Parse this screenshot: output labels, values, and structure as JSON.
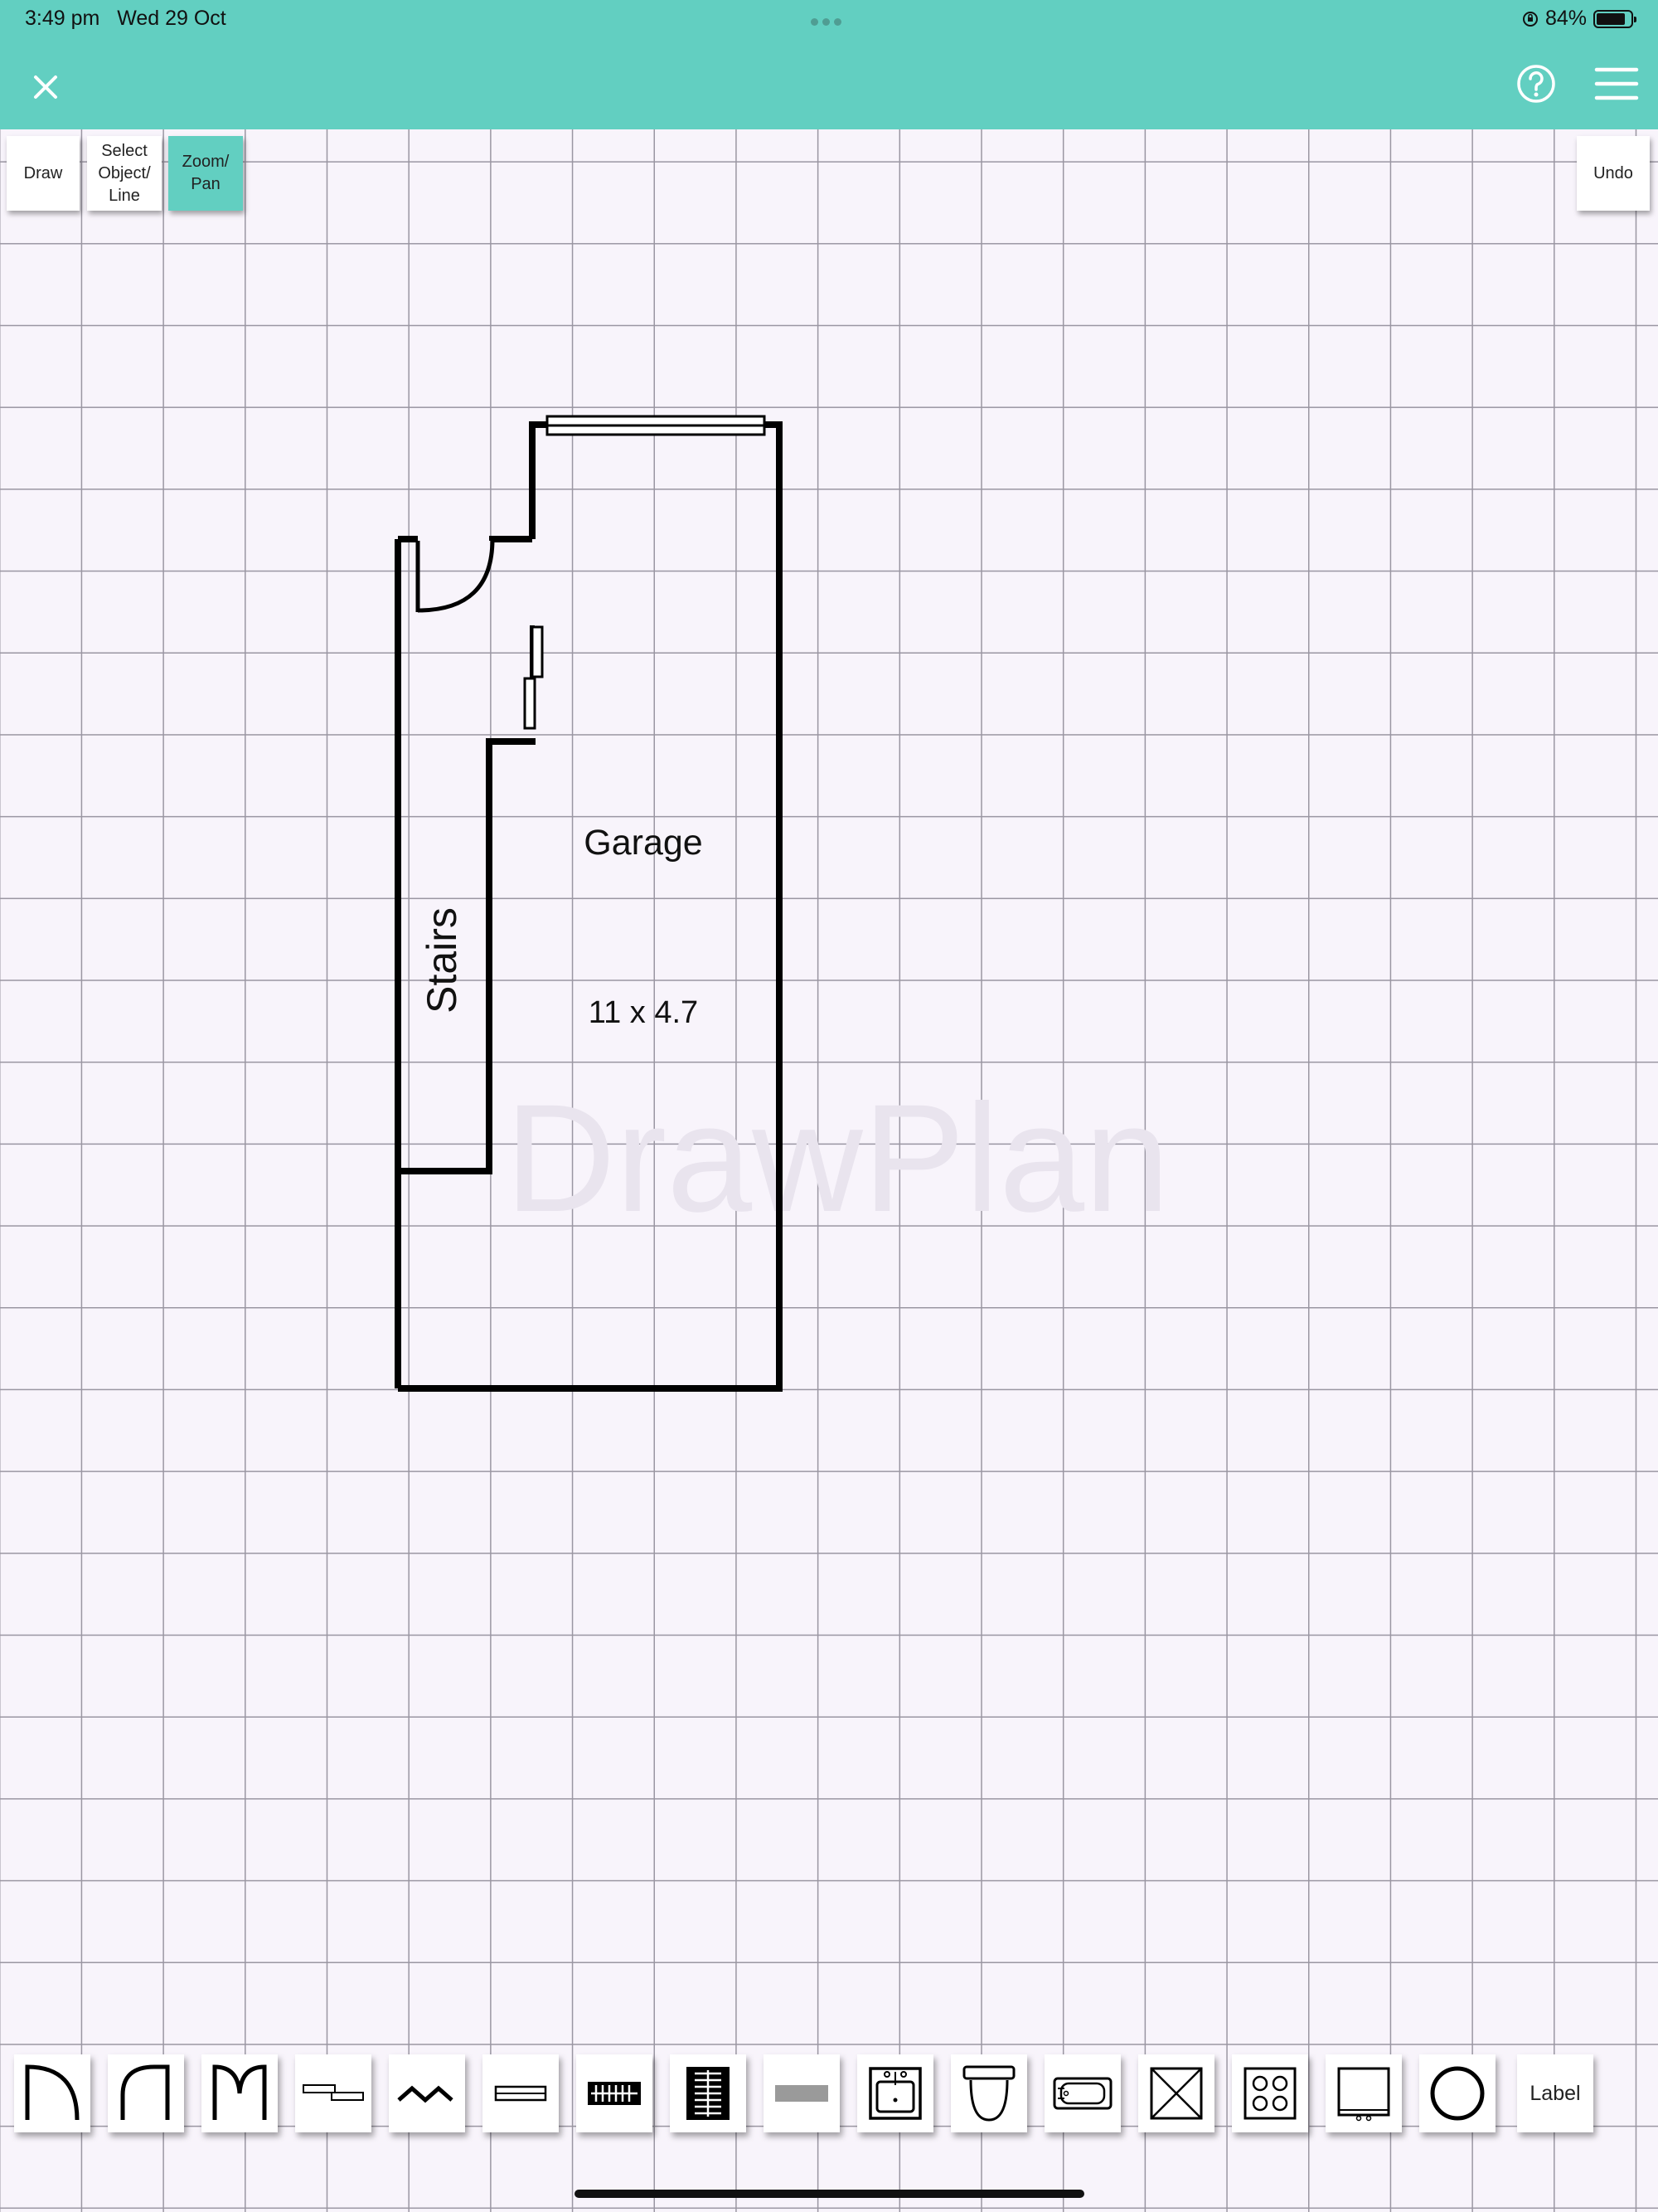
{
  "status_bar": {
    "time": "3:49 pm",
    "date": "Wed 29 Oct",
    "battery_percent": "84%",
    "battery_level": 0.84
  },
  "toolbar": {
    "draw_label": "Draw",
    "select_label_line1": "Select",
    "select_label_line2": "Object/",
    "select_label_line3": "Line",
    "zoom_label_line1": "Zoom/",
    "zoom_label_line2": "Pan",
    "undo_label": "Undo",
    "active_tool": "zoom-pan"
  },
  "plan": {
    "room_name": "Garage",
    "room_dimensions": "11 x 4.7",
    "stairs_label": "Stairs",
    "watermark": "DrawPlan"
  },
  "palette": {
    "items": [
      "door-single-swing-icon",
      "door-half-swing-icon",
      "door-double-swing-icon",
      "sliding-door-icon",
      "bifold-door-icon",
      "window-icon",
      "stairs-horizontal-icon",
      "stairs-vertical-icon",
      "wall-block-icon",
      "sink-icon",
      "toilet-icon",
      "bathtub-icon",
      "shower-icon",
      "cooktop-icon",
      "oven-icon",
      "circle-icon"
    ],
    "label_button": "Label"
  },
  "colors": {
    "header": "#62cfc1",
    "active_tool": "#62cfc1",
    "grid_background": "#f8f4fb",
    "grid_line": "#9a96a2"
  }
}
